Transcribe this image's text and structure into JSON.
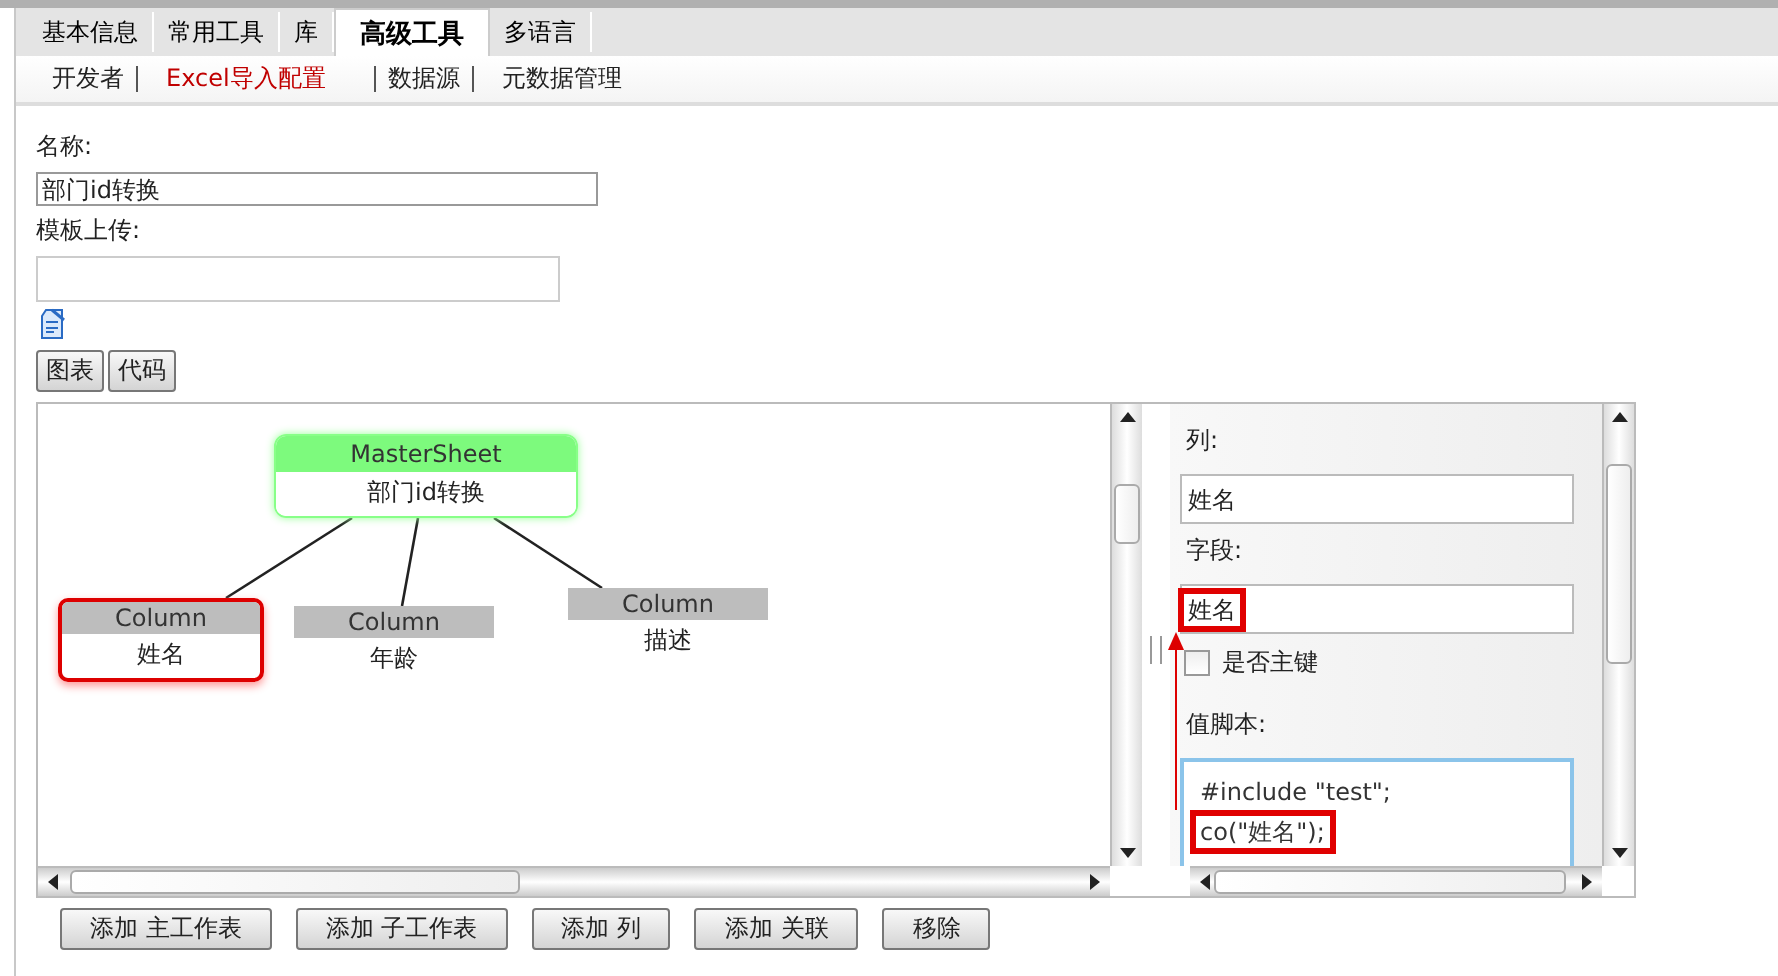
{
  "tabs": [
    {
      "label": "基本信息",
      "selected": false
    },
    {
      "label": "常用工具",
      "selected": false
    },
    {
      "label": "库",
      "selected": false
    },
    {
      "label": "高级工具",
      "selected": true
    },
    {
      "label": "多语言",
      "selected": false
    }
  ],
  "subtabs": [
    {
      "label": "开发者",
      "selected": false
    },
    {
      "label": "Excel导入配置",
      "selected": true
    },
    {
      "label": "数据源",
      "selected": false
    },
    {
      "label": "元数据管理",
      "selected": false
    }
  ],
  "form": {
    "name_label": "名称:",
    "name_value": "部门id转换",
    "template_label": "模板上传:"
  },
  "view_buttons": [
    "图表",
    "代码"
  ],
  "diagram": {
    "master": {
      "title": "MasterSheet",
      "label": "部门id转换"
    },
    "columns": [
      {
        "title": "Column",
        "label": "姓名",
        "selected": true
      },
      {
        "title": "Column",
        "label": "年龄",
        "selected": false
      },
      {
        "title": "Column",
        "label": "描述",
        "selected": false
      }
    ]
  },
  "properties": {
    "column_label": "列:",
    "column_value": "姓名",
    "field_label": "字段:",
    "field_value": "姓名",
    "primary_key_label": "是否主键",
    "primary_key_checked": false,
    "script_label": "值脚本:",
    "script_lines": [
      "#include \"test\";",
      "co(\"姓名\");"
    ]
  },
  "actions": [
    "添加 主工作表",
    "添加 子工作表",
    "添加 列",
    "添加 关联",
    "移除"
  ]
}
